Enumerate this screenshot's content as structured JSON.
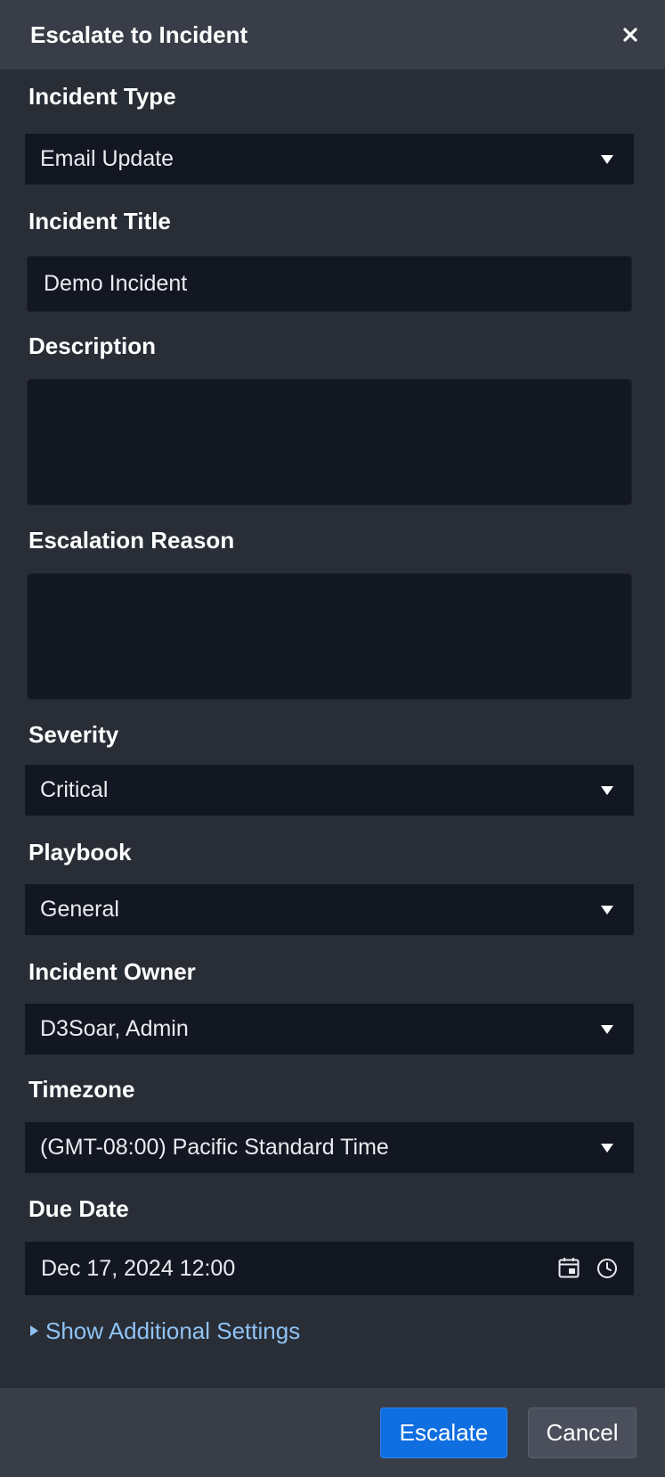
{
  "dialog": {
    "title": "Escalate to Incident"
  },
  "fields": {
    "incident_type": {
      "label": "Incident Type",
      "value": "Email Update"
    },
    "incident_title": {
      "label": "Incident Title",
      "value": "Demo Incident"
    },
    "description": {
      "label": "Description",
      "value": ""
    },
    "escalation_reason": {
      "label": "Escalation Reason",
      "value": ""
    },
    "severity": {
      "label": "Severity",
      "value": "Critical"
    },
    "playbook": {
      "label": "Playbook",
      "value": "General"
    },
    "incident_owner": {
      "label": "Incident Owner",
      "value": "D3Soar, Admin"
    },
    "timezone": {
      "label": "Timezone",
      "value": "(GMT-08:00) Pacific Standard Time"
    },
    "due_date": {
      "label": "Due Date",
      "value": "Dec 17, 2024 12:00"
    }
  },
  "additional_settings": {
    "label": "Show Additional Settings"
  },
  "buttons": {
    "escalate": "Escalate",
    "cancel": "Cancel"
  },
  "colors": {
    "background": "#292d36",
    "header": "#393d47",
    "input": "#131722",
    "accent": "#0f6ee0",
    "link": "#8fc3f5"
  },
  "icons": [
    "close-icon",
    "caret-down-icon",
    "calendar-icon",
    "clock-icon",
    "triangle-right-icon"
  ]
}
